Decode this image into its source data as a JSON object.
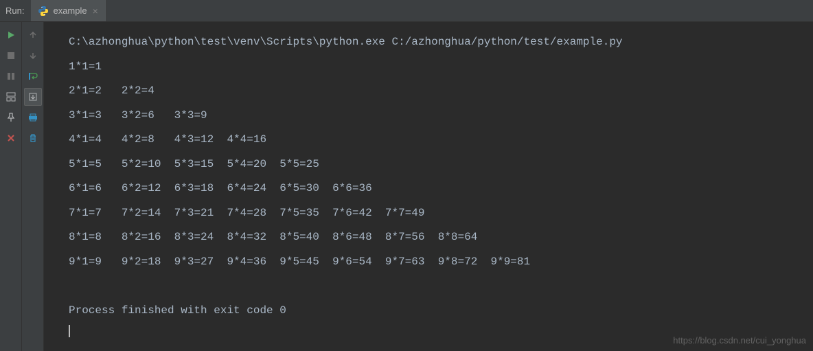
{
  "header": {
    "run_label": "Run:",
    "tab_label": "example"
  },
  "toolbar_left": {
    "run": "run-icon",
    "stop": "stop-icon",
    "pause": "pause-icon",
    "layout": "layout-icon",
    "pin": "pin-icon",
    "close": "close-icon"
  },
  "toolbar_right": {
    "up": "arrow-up-icon",
    "down": "arrow-down-icon",
    "wrap": "wrap-icon",
    "scroll": "scroll-icon",
    "print": "print-icon",
    "trash": "trash-icon"
  },
  "console": {
    "command": "C:\\azhonghua\\python\\test\\venv\\Scripts\\python.exe C:/azhonghua/python/test/example.py",
    "output_lines": [
      "1*1=1",
      "2*1=2   2*2=4",
      "3*1=3   3*2=6   3*3=9",
      "4*1=4   4*2=8   4*3=12  4*4=16",
      "5*1=5   5*2=10  5*3=15  5*4=20  5*5=25",
      "6*1=6   6*2=12  6*3=18  6*4=24  6*5=30  6*6=36",
      "7*1=7   7*2=14  7*3=21  7*4=28  7*5=35  7*6=42  7*7=49",
      "8*1=8   8*2=16  8*3=24  8*4=32  8*5=40  8*6=48  8*7=56  8*8=64",
      "9*1=9   9*2=18  9*3=27  9*4=36  9*5=45  9*6=54  9*7=63  9*8=72  9*9=81"
    ],
    "exit_message": "Process finished with exit code 0"
  },
  "watermark": "https://blog.csdn.net/cui_yonghua"
}
